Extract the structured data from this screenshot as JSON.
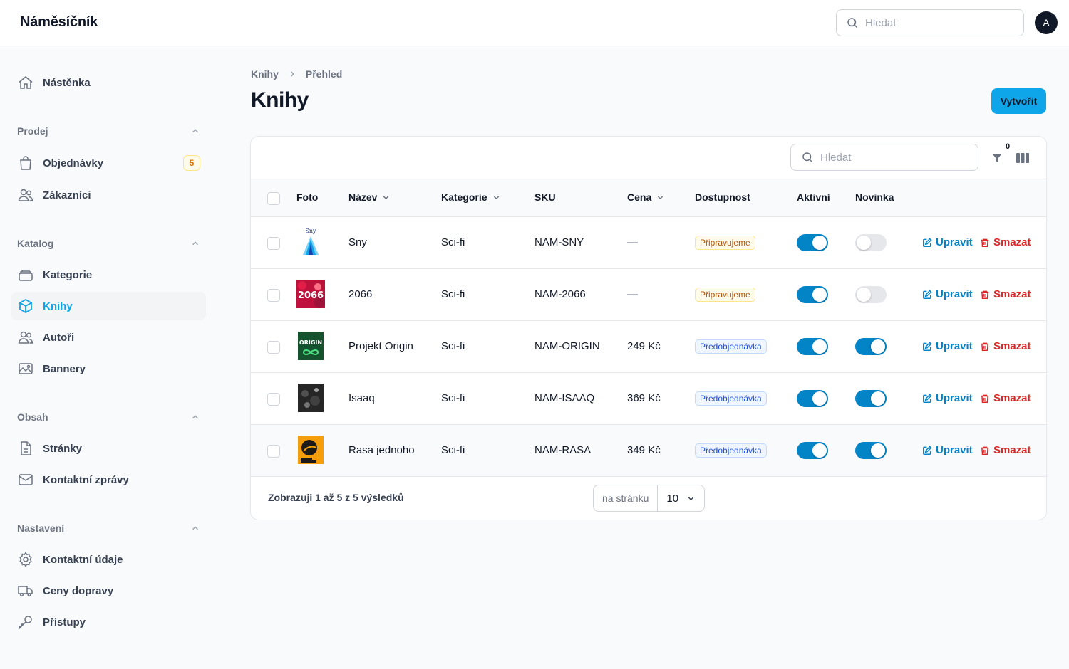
{
  "app": {
    "brand": "Náměsíčník",
    "search_placeholder": "Hledat",
    "avatar_initial": "A"
  },
  "sidebar": {
    "dashboard": "Nástěnka",
    "groups": {
      "sales": {
        "label": "Prodej",
        "items": {
          "orders": "Objednávky",
          "orders_badge": "5",
          "customers": "Zákazníci"
        }
      },
      "catalog": {
        "label": "Katalog",
        "items": {
          "categories": "Kategorie",
          "books": "Knihy",
          "authors": "Autoři",
          "banners": "Bannery"
        }
      },
      "content": {
        "label": "Obsah",
        "items": {
          "pages": "Stránky",
          "messages": "Kontaktní zprávy"
        }
      },
      "settings": {
        "label": "Nastavení",
        "items": {
          "contact": "Kontaktní údaje",
          "shipping": "Ceny dopravy",
          "access": "Přístupy"
        }
      }
    }
  },
  "page": {
    "breadcrumb": [
      "Knihy",
      "Přehled"
    ],
    "title": "Knihy",
    "create_label": "Vytvořit"
  },
  "table": {
    "search_placeholder": "Hledat",
    "filter_count": "0",
    "columns": [
      "Foto",
      "Název",
      "Kategorie",
      "SKU",
      "Cena",
      "Dostupnost",
      "Aktivní",
      "Novinka"
    ],
    "edit_label": "Upravit",
    "delete_label": "Smazat",
    "rows": [
      {
        "name": "Sny",
        "category": "Sci-fi",
        "sku": "NAM-SNY",
        "price": "—",
        "availability": "Připravujeme",
        "availability_kind": "warn",
        "active": true,
        "novelty": false
      },
      {
        "name": "2066",
        "category": "Sci-fi",
        "sku": "NAM-2066",
        "price": "—",
        "availability": "Připravujeme",
        "availability_kind": "warn",
        "active": true,
        "novelty": false
      },
      {
        "name": "Projekt Origin",
        "category": "Sci-fi",
        "sku": "NAM-ORIGIN",
        "price": "249 Kč",
        "availability": "Předobjednávka",
        "availability_kind": "info",
        "active": true,
        "novelty": true
      },
      {
        "name": "Isaaq",
        "category": "Sci-fi",
        "sku": "NAM-ISAAQ",
        "price": "369 Kč",
        "availability": "Předobjednávka",
        "availability_kind": "info",
        "active": true,
        "novelty": true
      },
      {
        "name": "Rasa jednoho",
        "category": "Sci-fi",
        "sku": "NAM-RASA",
        "price": "349 Kč",
        "availability": "Předobjednávka",
        "availability_kind": "info",
        "active": true,
        "novelty": true
      }
    ],
    "footer": {
      "summary": "Zobrazuji 1 až 5 z 5 výsledků",
      "per_page_label": "na stránku",
      "per_page_value": "10"
    }
  },
  "colors": {
    "primary": "#0ea5e9",
    "toggle_on": "#0284c7",
    "danger": "#dc2626"
  },
  "icons": {
    "dashboard": "home-icon",
    "orders": "shopping-bag-icon",
    "customers": "users-icon",
    "categories": "rectangle-stack-icon",
    "books": "cube-icon",
    "authors": "users-icon",
    "banners": "photo-icon",
    "pages": "document-icon",
    "messages": "envelope-icon",
    "contact": "cog-icon",
    "shipping": "truck-icon",
    "access": "key-icon"
  }
}
